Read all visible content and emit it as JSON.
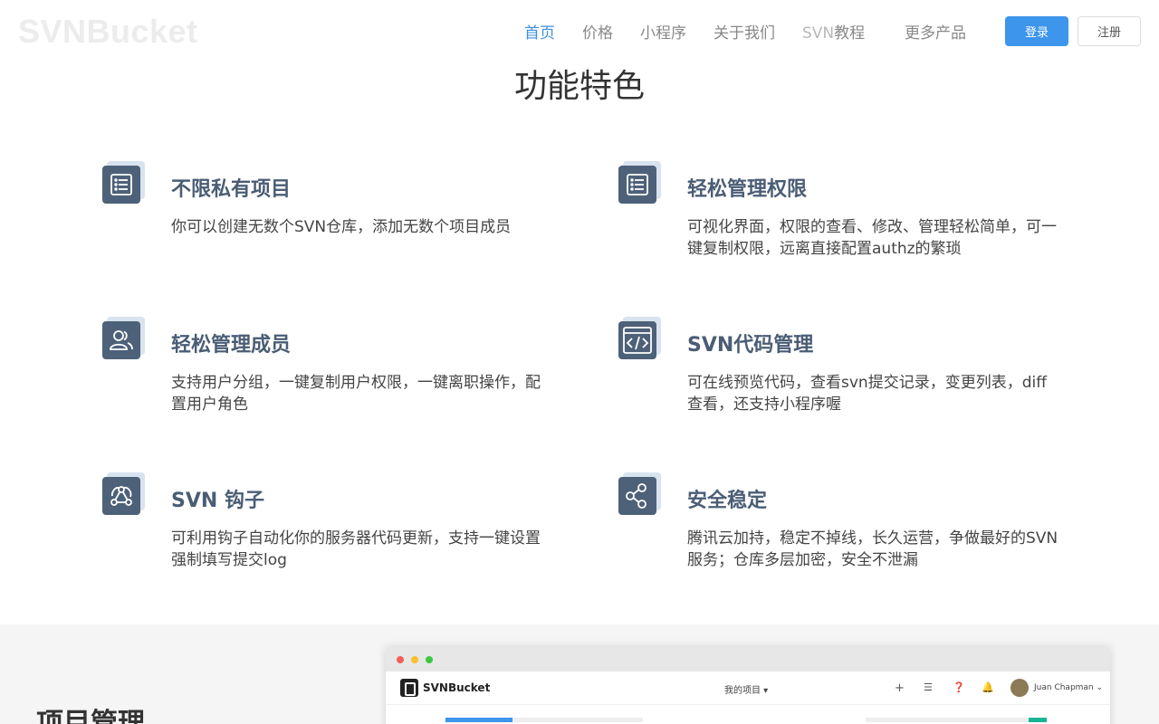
{
  "header": {
    "logo": "SVNBucket",
    "nav": [
      {
        "label": "首页",
        "active": true
      },
      {
        "label": "价格"
      },
      {
        "label": "小程序"
      },
      {
        "label": "关于我们"
      },
      {
        "label_prefix": "SVN",
        "label": "教程"
      },
      {
        "label": "更多产品"
      }
    ],
    "login": "登录",
    "register": "注册"
  },
  "features_section": {
    "title": "功能特色",
    "items": [
      {
        "icon": "list-icon",
        "title": "不限私有项目",
        "desc": "你可以创建无数个SVN仓库，添加无数个项目成员"
      },
      {
        "icon": "list-icon",
        "title": "轻松管理权限",
        "desc": "可视化界面，权限的查看、修改、管理轻松简单，可一键复制权限，远离直接配置authz的繁琐"
      },
      {
        "icon": "users-icon",
        "title": "轻松管理成员",
        "desc": "支持用户分组，一键复制用户权限，一键离职操作，配置用户角色"
      },
      {
        "icon": "code-icon",
        "title": "SVN代码管理",
        "desc": "可在线预览代码，查看svn提交记录，变更列表，diff查看，还支持小程序喔"
      },
      {
        "icon": "webhook-icon",
        "title": "SVN 钩子",
        "desc": "可利用钩子自动化你的服务器代码更新，支持一键设置强制填写提交log"
      },
      {
        "icon": "share-icon",
        "title": "安全稳定",
        "desc": "腾讯云加持，稳定不掉线，长久运营，争做最好的SVN服务；仓库多层加密，安全不泄漏"
      }
    ]
  },
  "bottom_section": {
    "title": "项目管理",
    "mock": {
      "logo": "SVNBucket",
      "menu": "我的项目",
      "user": "Juan Chapman"
    }
  },
  "colors": {
    "accent": "#3d8fe0",
    "icon_bg": "#4d6179",
    "title": "#4a5d75"
  }
}
